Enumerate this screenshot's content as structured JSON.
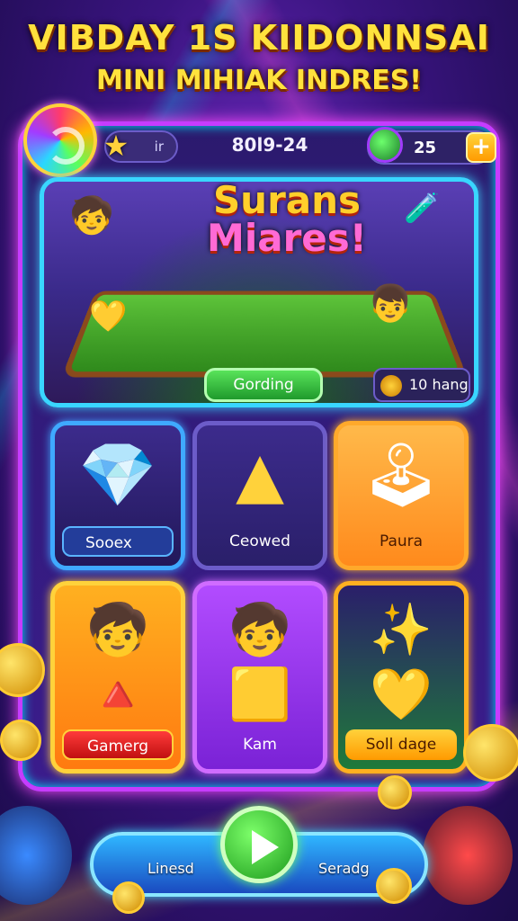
{
  "header": {
    "line1": "VIBDAY 1S KIIDONNSAI",
    "line2": "MINI MIHIAK INDRES!"
  },
  "top_bar": {
    "player_label": "ir",
    "score": "80l9-24",
    "coins": "25",
    "add_label": "+"
  },
  "hero": {
    "title_line1": "Surans",
    "title_line2": "Miares!",
    "start_label": "Gording",
    "info_label": "10 hang"
  },
  "cards": [
    {
      "label": "Sooex",
      "icon": "gem-icon"
    },
    {
      "label": "Ceowed",
      "icon": "pyramid-gem-icon"
    },
    {
      "label": "Paura",
      "icon": "arcade-machine-icon"
    },
    {
      "label": "Gamerg",
      "icon": "kids-gems-icon"
    },
    {
      "label": "Kam",
      "icon": "cube-icon"
    },
    {
      "label": "Soll dage",
      "icon": "party-room-icon"
    }
  ],
  "bottom_nav": {
    "left_label": "Linesd",
    "right_label": "Seradg"
  },
  "colors": {
    "accent": "#c63cff",
    "cyan": "#39d6ff",
    "gold": "#ffd23b",
    "green": "#59e35a"
  }
}
